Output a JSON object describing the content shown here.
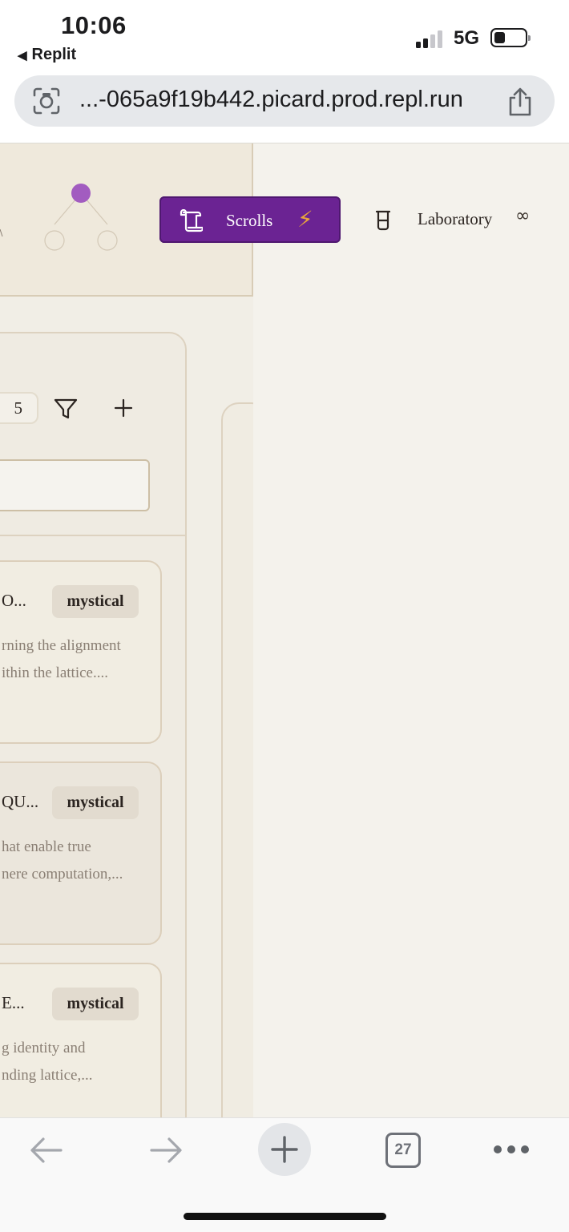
{
  "status_bar": {
    "time": "10:06",
    "back_app": "Replit",
    "network": "5G",
    "icons": [
      "signal-icon",
      "battery-icon"
    ]
  },
  "browser": {
    "url": "...-065a9f19b442.picard.prod.repl.run",
    "icons": [
      "lens-icon",
      "share-icon"
    ]
  },
  "nav": {
    "scrolls_label": "Scrolls",
    "scrolls_icon": "scroll-icon",
    "bolt_glyph": "⚡",
    "lab_label": "Laboratory",
    "lab_icon": "beaker-icon",
    "infinity_glyph": "∞",
    "active_color": "#6b2393"
  },
  "list": {
    "count": "5",
    "cards": [
      {
        "title": "O...",
        "tag": "mystical",
        "desc_line1": "rning the alignment",
        "desc_line2": "ithin the lattice...."
      },
      {
        "title": "QU...",
        "tag": "mystical",
        "desc_line1": "hat enable true",
        "desc_line2": "nere computation,..."
      },
      {
        "title": "E...",
        "tag": "mystical",
        "desc_line1": "g identity and",
        "desc_line2": "nding lattice,..."
      }
    ]
  },
  "toolbar": {
    "tabs_count": "27",
    "icons": [
      "back-arrow-icon",
      "forward-arrow-icon",
      "new-tab-icon",
      "tabs-icon",
      "more-icon"
    ]
  }
}
